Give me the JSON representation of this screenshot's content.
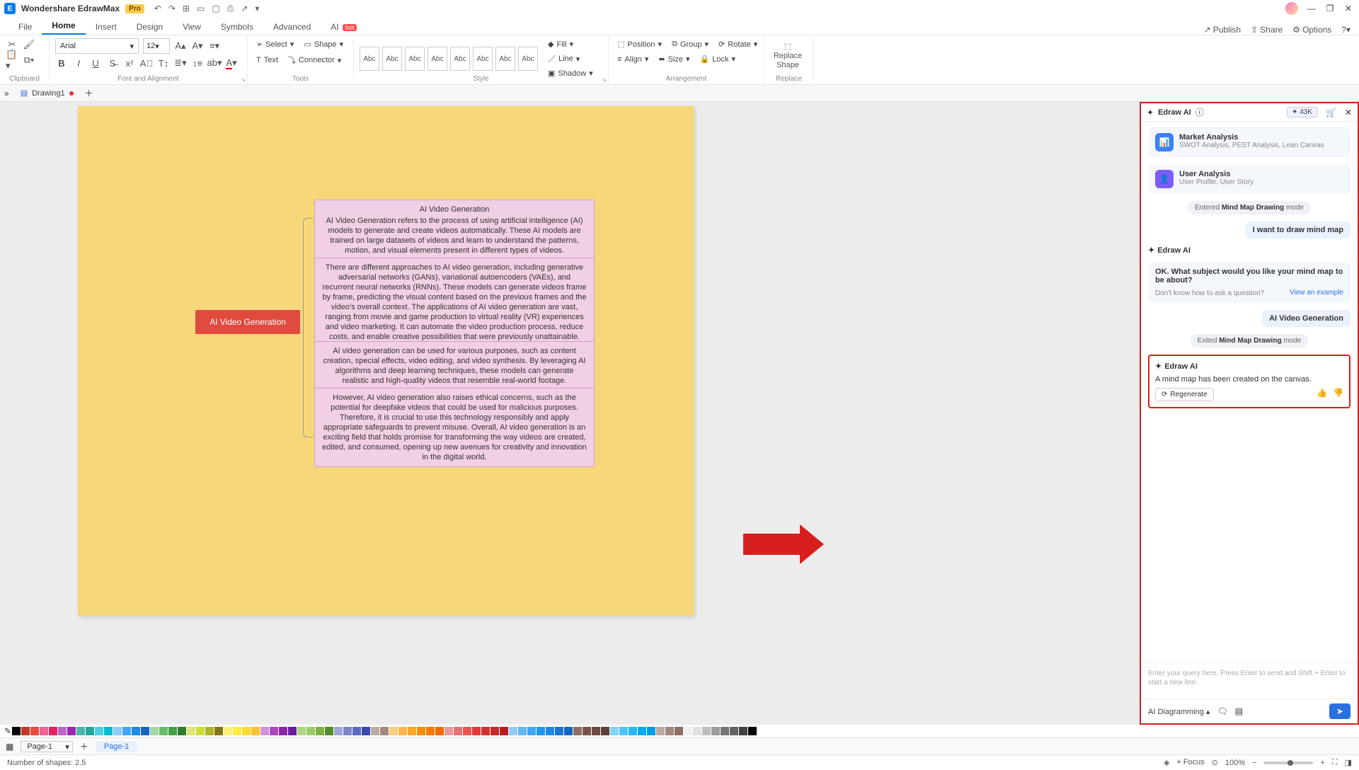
{
  "app": {
    "name": "Wondershare EdrawMax",
    "badge": "Pro"
  },
  "menu": {
    "items": [
      "File",
      "Home",
      "Insert",
      "Design",
      "View",
      "Symbols",
      "Advanced",
      "AI"
    ],
    "active": "Home",
    "ai_hot": "hot",
    "right": {
      "publish": "Publish",
      "share": "Share",
      "options": "Options"
    }
  },
  "ribbon": {
    "font_name": "Arial",
    "font_size": "12",
    "groups": {
      "clipboard": "Clipboard",
      "font": "Font and Alignment",
      "tools": "Tools",
      "style": "Style",
      "arrangement": "Arrangement",
      "replace": "Replace"
    },
    "tools": {
      "select": "Select",
      "shape": "Shape",
      "text": "Text",
      "connector": "Connector"
    },
    "style": {
      "abc": "Abc",
      "fill": "Fill",
      "line": "Line",
      "shadow": "Shadow"
    },
    "arrange": {
      "position": "Position",
      "group": "Group",
      "rotate": "Rotate",
      "align": "Align",
      "size": "Size",
      "lock": "Lock"
    },
    "replace_shape_l1": "Replace",
    "replace_shape_l2": "Shape"
  },
  "doc_tab": {
    "name": "Drawing1"
  },
  "mindmap": {
    "root": "AI Video Generation",
    "children": [
      {
        "title": "AI Video Generation",
        "body": "AI Video Generation refers to the process of using artificial intelligence (AI) models to generate and create videos automatically. These AI models are trained on large datasets of videos and learn to understand the patterns, motion, and visual elements present in different types of videos."
      },
      {
        "title": "",
        "body": "There are different approaches to AI video generation, including generative adversarial networks (GANs), variational autoencoders (VAEs), and recurrent neural networks (RNNs). These models can generate videos frame by frame, predicting the visual content based on the previous frames and the video's overall context. The applications of AI video generation are vast, ranging from movie and game production to virtual reality (VR) experiences and video marketing. It can automate the video production process, reduce costs, and enable creative possibilities that were previously unattainable."
      },
      {
        "title": "",
        "body": "AI video generation can be used for various purposes, such as content creation, special effects, video editing, and video synthesis. By leveraging AI algorithms and deep learning techniques, these models can generate realistic and high-quality videos that resemble real-world footage."
      },
      {
        "title": "",
        "body": "However, AI video generation also raises ethical concerns, such as the potential for deepfake videos that could be used for malicious purposes. Therefore, it is crucial to use this technology responsibly and apply appropriate safeguards to prevent misuse. Overall, AI video generation is an exciting field that holds promise for transforming the way videos are created, edited, and consumed, opening up new avenues for creativity and innovation in the digital world."
      }
    ]
  },
  "ai_panel": {
    "title": "Edraw AI",
    "count": "43K",
    "cards": [
      {
        "title": "Market Analysis",
        "sub": "SWOT Analysis, PEST Analysis, Lean Canvas",
        "color": "#3b82f6"
      },
      {
        "title": "User Analysis",
        "sub": "User Profile, User Story",
        "color": "#7c5cff"
      }
    ],
    "entered_pre": "Entered ",
    "entered_b": "Mind Map Drawing",
    "entered_post": " mode",
    "user1": "I want to draw mind map",
    "from": "Edraw AI",
    "question": "OK. What subject would you like your mind map to be about?",
    "hint": "Don't know how to ask a question?",
    "view_example": "View an example",
    "user2": "AI Video Generation",
    "exited_pre": "Exited ",
    "exited_b": "Mind Map Drawing",
    "exited_post": " mode",
    "result": "A mind map has been created on the canvas.",
    "regenerate": "Regenerate",
    "placeholder": "Enter your query here. Press Enter to send and Shift + Enter to start a new line.",
    "mode": "AI Diagramming"
  },
  "palette": [
    "#000",
    "#c0392b",
    "#e74c3c",
    "#f06292",
    "#e91e63",
    "#ba68c8",
    "#9c27b0",
    "#4db6ac",
    "#26a69a",
    "#4dd0e1",
    "#00bcd4",
    "#90caf9",
    "#42a5f5",
    "#1e88e5",
    "#1565c0",
    "#a5d6a7",
    "#66bb6a",
    "#43a047",
    "#2e7d32",
    "#dce775",
    "#cddc39",
    "#afb42b",
    "#827717",
    "#fff176",
    "#ffeb3b",
    "#fdd835",
    "#fbc02d",
    "#ce93d8",
    "#ab47bc",
    "#8e24aa",
    "#6a1b9a",
    "#aed581",
    "#9ccc65",
    "#7cb342",
    "#558b2f",
    "#9fa8da",
    "#7986cb",
    "#5c6bc0",
    "#3949ab",
    "#bcaaa4",
    "#a1887f",
    "#ffcc80",
    "#ffb74d",
    "#ffa726",
    "#fb8c00",
    "#f57c00",
    "#ef6c00",
    "#ef9a9a",
    "#e57373",
    "#ef5350",
    "#e53935",
    "#d32f2f",
    "#c62828",
    "#b71c1c",
    "#90caf9",
    "#64b5f6",
    "#42a5f5",
    "#2196f3",
    "#1e88e5",
    "#1976d2",
    "#1565c0",
    "#8d6e63",
    "#795548",
    "#6d4c41",
    "#5d4037",
    "#81d4fa",
    "#4fc3f7",
    "#29b6f6",
    "#03a9f4",
    "#039be5",
    "#bcaaa4",
    "#a1887f",
    "#8d6e63",
    "#eeeeee",
    "#e0e0e0",
    "#bdbdbd",
    "#9e9e9e",
    "#757575",
    "#616161",
    "#424242",
    "#000000",
    "#ffffff"
  ],
  "page": {
    "selector": "Page-1",
    "tab": "Page-1"
  },
  "status": {
    "shapes_label": "Number of shapes:",
    "shapes": "2.5",
    "focus": "Focus",
    "zoom": "100%"
  }
}
